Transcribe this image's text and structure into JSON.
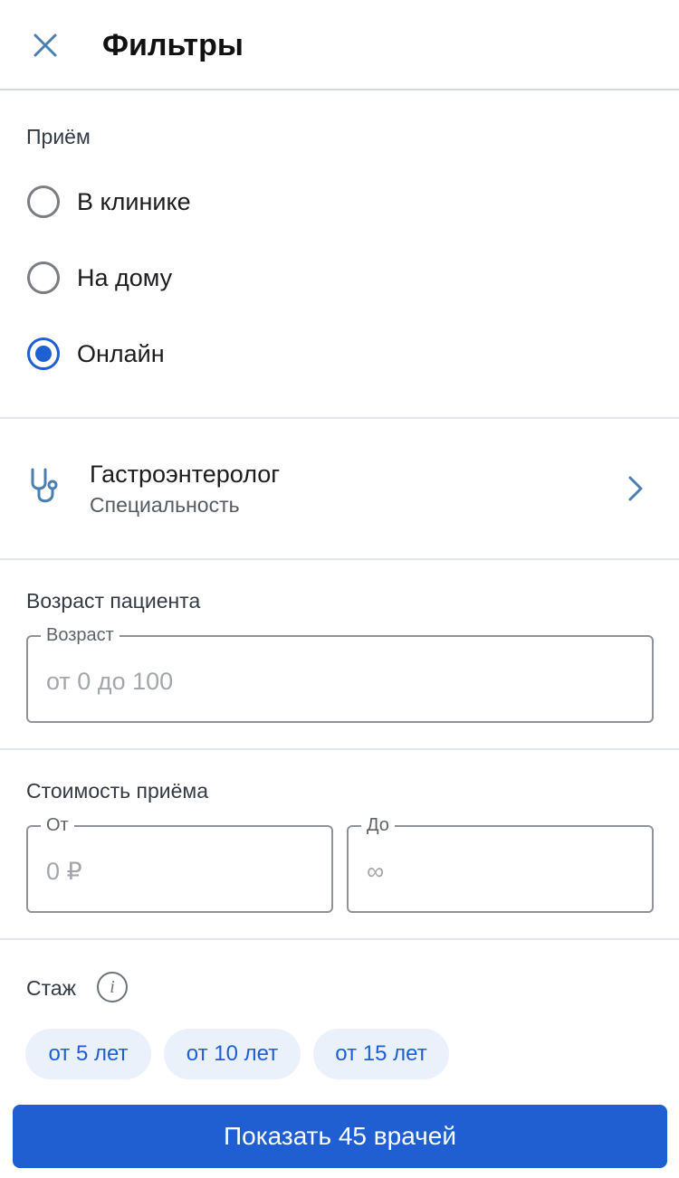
{
  "header": {
    "title": "Фильтры",
    "close_icon": "close-icon"
  },
  "appointment": {
    "label": "Приём",
    "options": [
      {
        "label": "В клинике",
        "checked": false
      },
      {
        "label": "На дому",
        "checked": false
      },
      {
        "label": "Онлайн",
        "checked": true
      }
    ]
  },
  "specialty": {
    "icon": "stethoscope-icon",
    "value": "Гастроэнтеролог",
    "caption": "Специальность",
    "chevron": "chevron-right-icon"
  },
  "age": {
    "label": "Возраст пациента",
    "field_legend": "Возраст",
    "placeholder": "от 0 до 100"
  },
  "price": {
    "label": "Стоимость приёма",
    "from_legend": "От",
    "from_placeholder": "0 ₽",
    "to_legend": "До",
    "to_placeholder": "∞"
  },
  "experience": {
    "label": "Стаж",
    "info_icon": "info-icon",
    "info_glyph": "i",
    "chips": [
      "от 5 лет",
      "от 10 лет",
      "от 15 лет"
    ]
  },
  "footer": {
    "button_label": "Показать 45 врачей"
  },
  "colors": {
    "accent": "#1f5fd1",
    "chip_bg": "#eaf1fb"
  }
}
